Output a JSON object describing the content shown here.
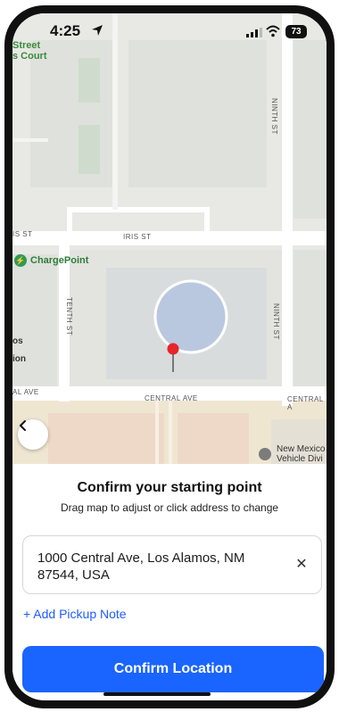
{
  "status_bar": {
    "time": "4:25",
    "battery": "73"
  },
  "map": {
    "labels": {
      "street_top": "Street",
      "court": "s Court",
      "iris_left": "IS ST",
      "iris": "IRIS ST",
      "ninth_top": "NINTH ST",
      "ninth_mid": "NINTH ST",
      "tenth": "TENTH ST",
      "central_left": "AL AVE",
      "central": "CENTRAL AVE",
      "central_right": "CENTRAL A",
      "os": "os",
      "ion": "ion",
      "chargepoint": "ChargePoint",
      "nm_line1": "New Mexico",
      "nm_line2": "Vehicle Divi"
    }
  },
  "sheet": {
    "title": "Confirm your starting point",
    "subtitle": "Drag map to adjust or click address to change",
    "address": "1000 Central Ave, Los Alamos, NM 87544, USA",
    "clear_glyph": "✕",
    "add_note": "+ Add Pickup Note",
    "confirm_label": "Confirm Location"
  },
  "icons": [
    "location-arrow-icon",
    "signal-icon",
    "wifi-icon",
    "battery-icon",
    "chargepoint-icon",
    "map-pin-icon",
    "chevron-left-icon",
    "close-icon"
  ],
  "colors": {
    "primary": "#1a64ff",
    "link": "#1f5cff",
    "chargepoint_green": "#2e9a55"
  }
}
